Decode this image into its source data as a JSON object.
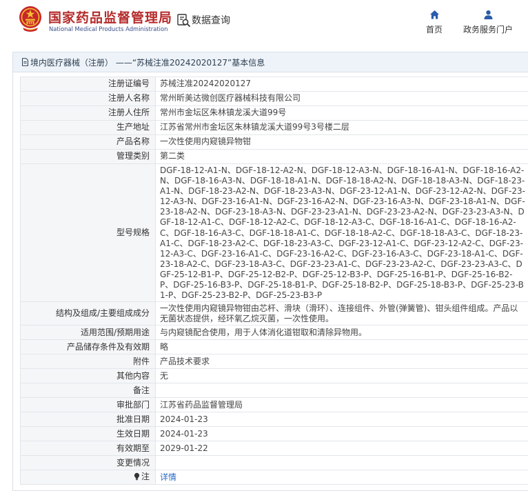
{
  "header": {
    "agency_name_cn": "国家药品监督管理局",
    "agency_name_en": "National Medical Products Administration",
    "data_query_label": "数据查询",
    "nav": [
      {
        "label": "首页",
        "icon": "home-icon"
      },
      {
        "label": "政务服务门户",
        "icon": "user-icon"
      }
    ]
  },
  "panel": {
    "title": "境内医疗器械（注册） ——“苏械注准20242020127”基本信息"
  },
  "fields": [
    {
      "label": "注册证编号",
      "value": "苏械注准20242020127"
    },
    {
      "label": "注册人名称",
      "value": "常州昕美达微创医疗器械科技有限公司"
    },
    {
      "label": "注册人住所",
      "value": "常州市金坛区朱林镇龙溪大道99号"
    },
    {
      "label": "生产地址",
      "value": "江苏省常州市金坛区朱林镇龙溪大道99号3号楼二层"
    },
    {
      "label": "产品名称",
      "value": "一次性使用内窥镜异物钳"
    },
    {
      "label": "管理类别",
      "value": "第二类"
    },
    {
      "label": "型号规格",
      "value": "DGF-18-12-A1-N、DGF-18-12-A2-N、DGF-18-12-A3-N、DGF-18-16-A1-N、DGF-18-16-A2-N、DGF-18-16-A3-N、DGF-18-18-A1-N、DGF-18-18-A2-N、DGF-18-18-A3-N、DGF-18-23-A1-N、DGF-18-23-A2-N、DGF-18-23-A3-N、DGF-23-12-A1-N、DGF-23-12-A2-N、DGF-23-12-A3-N、DGF-23-16-A1-N、DGF-23-16-A2-N、DGF-23-16-A3-N、DGF-23-18-A1-N、DGF-23-18-A2-N、DGF-23-18-A3-N、DGF-23-23-A1-N、DGF-23-23-A2-N、DGF-23-23-A3-N、DGF-18-12-A1-C、DGF-18-12-A2-C、DGF-18-12-A3-C、DGF-18-16-A1-C、DGF-18-16-A2-C、DGF-18-16-A3-C、DGF-18-18-A1-C、DGF-18-18-A2-C、DGF-18-18-A3-C、DGF-18-23-A1-C、DGF-18-23-A2-C、DGF-18-23-A3-C、DGF-23-12-A1-C、DGF-23-12-A2-C、DGF-23-12-A3-C、DGF-23-16-A1-C、DGF-23-16-A2-C、DGF-23-16-A3-C、DGF-23-18-A1-C、DGF-23-18-A2-C、DGF-23-18-A3-C、DGF-23-23-A1-C、DGF-23-23-A2-C、DGF-23-23-A3-C、DGF-25-12-B1-P、DGF-25-12-B2-P、DGF-25-12-B3-P、DGF-25-16-B1-P、DGF-25-16-B2-P、DGF-25-16-B3-P、DGF-25-18-B1-P、DGF-25-18-B2-P、DGF-25-18-B3-P、DGF-25-23-B1-P、DGF-25-23-B2-P、DGF-25-23-B3-P"
    },
    {
      "label": "结构及组成/主要组成成分",
      "value": "一次性使用内窥镜异物钳由芯杆、滑块（滑环）、连接组件、外管(弹簧管)、钳头组件组成。产品以无菌状态提供，经环氧乙烷灭菌，一次性使用。"
    },
    {
      "label": "适用范围/预期用途",
      "value": "与内窥镜配合使用，用于人体消化道钳取和清除异物用。"
    },
    {
      "label": "产品储存条件及有效期",
      "value": "略"
    },
    {
      "label": "附件",
      "value": "产品技术要求"
    },
    {
      "label": "其他内容",
      "value": "无"
    },
    {
      "label": "备注",
      "value": ""
    },
    {
      "label": "审批部门",
      "value": "江苏省药品监督管理局"
    },
    {
      "label": "批准日期",
      "value": "2024-01-23"
    },
    {
      "label": "生效日期",
      "value": "2024-01-23"
    },
    {
      "label": "有效期至",
      "value": "2029-01-22"
    },
    {
      "label": "变更情况",
      "value": ""
    }
  ],
  "note": {
    "label": "注",
    "icon": "lightbulb-icon",
    "link_label": "详情"
  },
  "colors": {
    "agency_red": "#b52b2b",
    "brand_blue": "#2a5caa",
    "label_bg": "#f5f6f8",
    "title_bg": "#eef3f9",
    "link": "#2d6bc4"
  }
}
